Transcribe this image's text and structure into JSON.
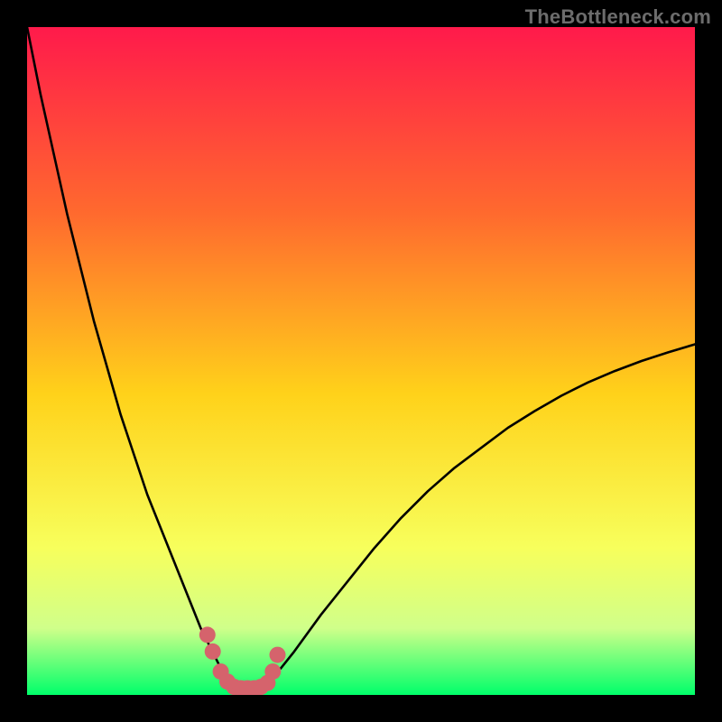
{
  "watermark": "TheBottleneck.com",
  "colors": {
    "bg": "#000000",
    "grad_top": "#ff1a4b",
    "grad_mid_top": "#ff6a2e",
    "grad_mid": "#ffd21a",
    "grad_mid_low": "#f7ff5c",
    "grad_low": "#d0ff8a",
    "grad_bottom": "#00ff6a",
    "curve": "#000000",
    "dots": "#d5636c"
  },
  "chart_data": {
    "type": "line",
    "title": "",
    "xlabel": "",
    "ylabel": "",
    "xlim": [
      0,
      100
    ],
    "ylim": [
      0,
      100
    ],
    "grid": false,
    "legend": false,
    "series": [
      {
        "name": "bottleneck-curve",
        "x": [
          0,
          2,
          4,
          6,
          8,
          10,
          12,
          14,
          16,
          18,
          20,
          22,
          24,
          26,
          27,
          28,
          29,
          30,
          31,
          32,
          33,
          34,
          36,
          38,
          40,
          44,
          48,
          52,
          56,
          60,
          64,
          68,
          72,
          76,
          80,
          84,
          88,
          92,
          96,
          100
        ],
        "values": [
          100,
          90,
          81,
          72,
          64,
          56,
          49,
          42,
          36,
          30,
          25,
          20,
          15,
          10,
          8,
          6,
          4,
          2.5,
          1.5,
          1,
          1,
          1.3,
          2.2,
          4,
          6.5,
          12,
          17,
          22,
          26.5,
          30.5,
          34,
          37,
          40,
          42.5,
          44.8,
          46.8,
          48.5,
          50,
          51.3,
          52.5
        ]
      }
    ],
    "highlight_points": {
      "name": "near-zero-dots",
      "x": [
        27,
        27.8,
        29,
        30,
        31,
        32,
        33,
        34,
        35,
        36,
        36.8,
        37.5
      ],
      "y": [
        9,
        6.5,
        3.5,
        2,
        1.2,
        1,
        1,
        1,
        1.2,
        1.8,
        3.5,
        6
      ]
    }
  }
}
